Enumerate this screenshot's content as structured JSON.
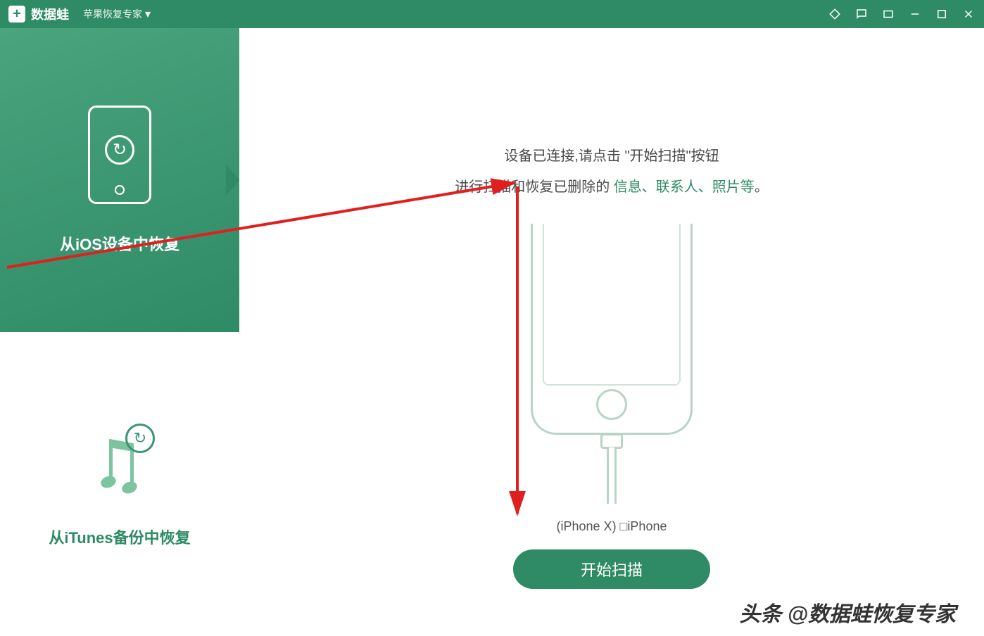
{
  "titlebar": {
    "brand": "数据蛙",
    "subtitle": "苹果恢复专家"
  },
  "sidebar": {
    "items": [
      {
        "label": "从iOS设备中恢复"
      },
      {
        "label": "从iTunes备份中恢复"
      }
    ]
  },
  "main": {
    "instruction_line1_prefix": "设备已连接,请点击 \"",
    "instruction_line1_em": "开始扫描",
    "instruction_line1_suffix": "\"按钮",
    "instruction_line2_prefix": "进行扫描和恢复已删除的 ",
    "instruction_line2_items": "信息、联系人、照片等",
    "instruction_line2_suffix": "。",
    "device_label": "(iPhone X) □iPhone",
    "scan_button": "开始扫描"
  },
  "watermark": "头条 @数据蛙恢复专家"
}
